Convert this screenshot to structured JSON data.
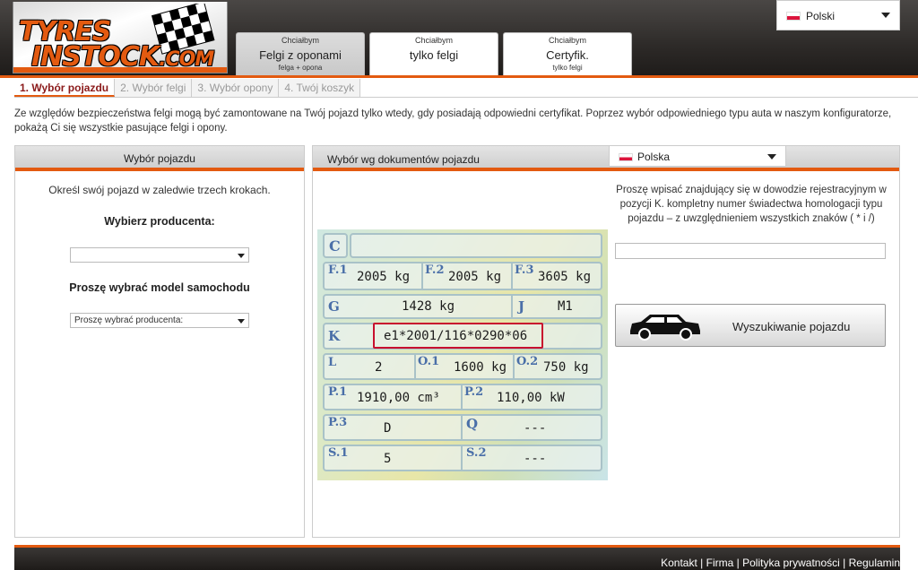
{
  "header": {
    "logo_text_1": "TYRES",
    "logo_text_2": "INSTOCK",
    "logo_text_3": ".COM",
    "accent_color": "#e35a10",
    "language": {
      "label": "Polski",
      "flag": "poland-flag-icon"
    },
    "tabs": [
      {
        "small": "Chciałbym",
        "big": "Felgi z oponami",
        "sub": "felga + opona",
        "active": true
      },
      {
        "small": "Chciałbym",
        "big": "tylko felgi",
        "sub": "",
        "active": false
      },
      {
        "small": "Chciałbym",
        "big": "Certyfik.",
        "sub": "tylko felgi",
        "active": false
      }
    ]
  },
  "steps": [
    {
      "label": "1. Wybór pojazdu",
      "active": true
    },
    {
      "label": "2. Wybór felgi",
      "active": false
    },
    {
      "label": "3. Wybór opony",
      "active": false
    },
    {
      "label": "4. Twój koszyk",
      "active": false
    }
  ],
  "intro": "Ze względów bezpieczeństwa felgi mogą być zamontowane na Twój pojazd tylko wtedy, gdy posiadają odpowiedni certyfikat. Poprzez wybór odpowiedniego typu auta w naszym konfiguratorze, pokażą Ci się wszystkie pasujące felgi i opony.",
  "left_panel": {
    "title": "Wybór pojazdu",
    "hint": "Określ swój pojazd w zaledwie trzech krokach.",
    "manufacturer_label": "Wybierz producenta:",
    "manufacturer_value": "",
    "model_label": "Proszę wybrać model samochodu",
    "model_value": "Proszę wybrać producenta:"
  },
  "right_panel": {
    "title": "Wybór wg dokumentów pojazdu",
    "country": {
      "label": "Polska",
      "flag": "poland-flag-icon"
    },
    "instructions": "Proszę wpisać znajdujący się w dowodzie rejestracyjnym w pozycji K. kompletny numer świadectwa homologacji typu pojazdu – z uwzględnieniem wszystkich znaków ( * i /)",
    "k_input_value": "",
    "search_button": "Wyszukiwanie pojazdu",
    "search_icon": "car-icon"
  },
  "document": {
    "C": "C",
    "F1_code": "F.1",
    "F1": "2005 kg",
    "F2_code": "F.2",
    "F2": "2005 kg",
    "F3_code": "F.3",
    "F3": "3605 kg",
    "G_code": "G",
    "G": "1428 kg",
    "J_code": "J",
    "J": "M1",
    "K_code": "K",
    "K": "e1*2001/116*0290*06",
    "L_code": "L",
    "L": "2",
    "O1_code": "O.1",
    "O1": "1600 kg",
    "O2_code": "O.2",
    "O2": "750 kg",
    "P1_code": "P.1",
    "P1": "1910,00 cm³",
    "P2_code": "P.2",
    "P2": "110,00 kW",
    "P3_code": "P.3",
    "P3": "D",
    "Q_code": "Q",
    "Q": "---",
    "S1_code": "S.1",
    "S1": "5",
    "S2_code": "S.2",
    "S2": "---"
  },
  "footer": {
    "links": [
      "Kontakt",
      "Firma",
      "Polityka prywatności",
      "Regulamin"
    ],
    "separator": "|"
  }
}
